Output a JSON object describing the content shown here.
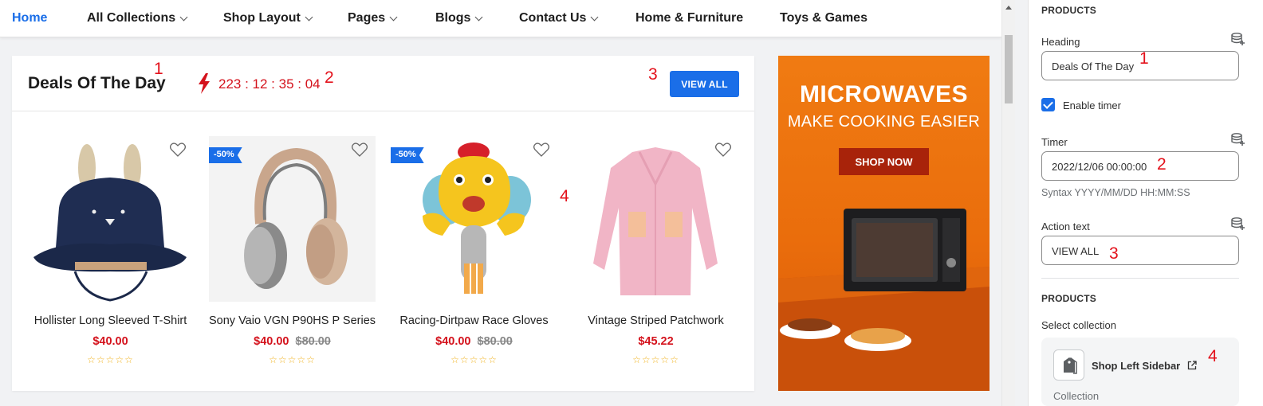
{
  "nav": {
    "items": [
      {
        "label": "Home",
        "dropdown": false,
        "active": true
      },
      {
        "label": "All Collections",
        "dropdown": true
      },
      {
        "label": "Shop Layout",
        "dropdown": true
      },
      {
        "label": "Pages",
        "dropdown": true
      },
      {
        "label": "Blogs",
        "dropdown": true
      },
      {
        "label": "Contact Us",
        "dropdown": true
      },
      {
        "label": "Home & Furniture",
        "dropdown": false
      },
      {
        "label": "Toys & Games",
        "dropdown": false
      }
    ]
  },
  "deals": {
    "title": "Deals Of The Day",
    "countdown": "223 : 12 : 35 : 04",
    "view_all": "VIEW ALL",
    "products": [
      {
        "name": "Hollister Long Sleeved T-Shirt",
        "price": "$40.00",
        "old_price": "",
        "badge": "",
        "stars": "☆☆☆☆☆"
      },
      {
        "name": "Sony Vaio VGN P90HS P Series",
        "price": "$40.00",
        "old_price": "$80.00",
        "badge": "-50%",
        "stars": "☆☆☆☆☆"
      },
      {
        "name": "Racing-Dirtpaw Race Gloves",
        "price": "$40.00",
        "old_price": "$80.00",
        "badge": "-50%",
        "stars": "☆☆☆☆☆"
      },
      {
        "name": "Vintage Striped Patchwork",
        "price": "$45.22",
        "old_price": "",
        "badge": "",
        "stars": "☆☆☆☆☆"
      }
    ]
  },
  "banner": {
    "title": "MICROWAVES",
    "subtitle": "MAKE COOKING EASIER",
    "button": "SHOP NOW"
  },
  "panel": {
    "section1_title": "PRODUCTS",
    "heading_label": "Heading",
    "heading_value": "Deals Of The Day",
    "enable_timer_label": "Enable timer",
    "enable_timer_checked": true,
    "timer_label": "Timer",
    "timer_value": "2022/12/06 00:00:00",
    "timer_hint": "Syntax YYYY/MM/DD HH:MM:SS",
    "action_label": "Action text",
    "action_value": "VIEW ALL",
    "section2_title": "PRODUCTS",
    "select_collection_label": "Select collection",
    "collection_name": "Shop Left Sidebar",
    "collection_type": "Collection"
  },
  "annotations": {
    "m1": "1",
    "m2": "2",
    "m3": "3",
    "m4": "4",
    "p1": "1",
    "p2": "2",
    "p3": "3",
    "p4": "4"
  },
  "colors": {
    "accent": "#1a6ee8",
    "price_red": "#d4121c",
    "annotation_red": "#e3111b",
    "banner_orange": "#ea6d0c"
  }
}
